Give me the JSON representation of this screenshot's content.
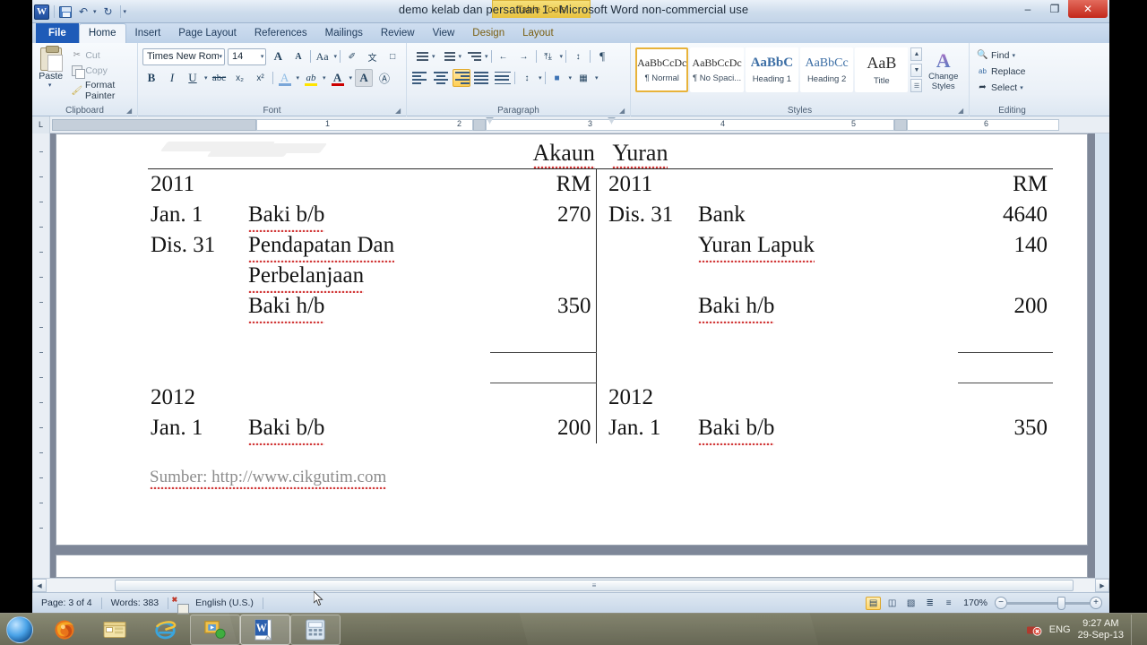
{
  "window": {
    "title": "demo kelab dan persatuan 1  -  Microsoft Word non-commercial use",
    "context_tab_group": "Table Tools",
    "minimize_glyph": "–",
    "restore_glyph": "❐",
    "close_glyph": "✕"
  },
  "quick_access": {
    "app_button": "W",
    "save_tooltip": "Save",
    "undo_glyph": "↶",
    "redo_glyph": "↻",
    "customize_glyph": "▾"
  },
  "tabs": [
    {
      "label": "File",
      "state": "file"
    },
    {
      "label": "Home",
      "state": "active"
    },
    {
      "label": "Insert",
      "state": "normal"
    },
    {
      "label": "Page Layout",
      "state": "normal"
    },
    {
      "label": "References",
      "state": "normal"
    },
    {
      "label": "Mailings",
      "state": "normal"
    },
    {
      "label": "Review",
      "state": "normal"
    },
    {
      "label": "View",
      "state": "normal"
    },
    {
      "label": "Design",
      "state": "context"
    },
    {
      "label": "Layout",
      "state": "context"
    }
  ],
  "ribbon": {
    "clipboard": {
      "group_label": "Clipboard",
      "paste_label": "Paste",
      "paste_arrow": "▾",
      "cut_label": "Cut",
      "copy_label": "Copy",
      "format_painter_label": "Format Painter"
    },
    "font": {
      "group_label": "Font",
      "font_name": "Times New Roma",
      "font_size": "14",
      "grow_font": "A",
      "shrink_font": "A",
      "change_case": "Aa",
      "clear_formatting": "✐",
      "bold": "B",
      "italic": "I",
      "underline": "U",
      "strikethrough": "abc",
      "subscript": "x₂",
      "superscript": "x²",
      "text_effects": "A",
      "highlight": "ab",
      "font_color": "A",
      "phonetic": "文",
      "enclose": "Ⓐ",
      "dropdown_arrow": "▾"
    },
    "paragraph": {
      "group_label": "Paragraph",
      "bullets": "•",
      "numbering": "1.",
      "multilevel": "≡",
      "decrease_indent": "←",
      "increase_indent": "→",
      "sort": "↕",
      "show_marks": "¶",
      "align_left": "left",
      "align_center": "center",
      "align_right": "right",
      "align_justify": "justify",
      "distributed": "distributed",
      "line_spacing": "↕",
      "shading": "■",
      "borders": "▦",
      "active_alignment": "align_right"
    },
    "styles": {
      "group_label": "Styles",
      "items": [
        {
          "preview": "AaBbCcDc",
          "name": "¶ Normal",
          "selected": true
        },
        {
          "preview": "AaBbCcDc",
          "name": "¶ No Spaci...",
          "selected": false
        },
        {
          "preview": "AaBbC",
          "name": "Heading 1",
          "selected": false
        },
        {
          "preview": "AaBbCc",
          "name": "Heading 2",
          "selected": false
        },
        {
          "preview": "AaB",
          "name": "Title",
          "selected": false
        }
      ],
      "change_styles_line1": "Change",
      "change_styles_line2": "Styles",
      "change_styles_arrow": "▾",
      "scroll_up": "▲",
      "scroll_down": "▼",
      "more": "☰"
    },
    "editing": {
      "group_label": "Editing",
      "find_label": "Find",
      "find_arrow": "▾",
      "replace_label": "Replace",
      "select_label": "Select",
      "select_arrow": "▾"
    },
    "help_glyph": "?",
    "minimize_ribbon_glyph": "▴"
  },
  "ruler": {
    "corner_label": "L",
    "h_numbers": [
      "1",
      "2",
      "3",
      "4",
      "5",
      "6"
    ]
  },
  "document": {
    "title_left": "Akaun",
    "title_right": "Yuran",
    "left_side": {
      "year_header": "2011",
      "currency_header": "RM",
      "rows": [
        {
          "date": "Jan. 1",
          "desc": "Baki b/b",
          "spell": true,
          "amount": "270"
        },
        {
          "date": "Dis. 31",
          "desc": "Pendapatan Dan",
          "spell": true,
          "amount": ""
        },
        {
          "date": "",
          "desc": "Perbelanjaan",
          "spell": true,
          "amount": ""
        },
        {
          "date": "",
          "desc": "Baki h/b",
          "spell": true,
          "amount": "350"
        }
      ],
      "closing_year": "2012",
      "closing_row": {
        "date": "Jan. 1",
        "desc": "Baki b/b",
        "amount": "200"
      }
    },
    "right_side": {
      "year_header": "2011",
      "currency_header": "RM",
      "rows": [
        {
          "date": "Dis. 31",
          "desc": "Bank",
          "spell": false,
          "amount": "4640"
        },
        {
          "date": "",
          "desc": "Yuran Lapuk",
          "spell": true,
          "amount": "140"
        },
        {
          "date": "",
          "desc": "",
          "spell": false,
          "amount": ""
        },
        {
          "date": "",
          "desc": "Baki h/b",
          "spell": true,
          "amount": "200"
        }
      ],
      "closing_year": "2012",
      "closing_row": {
        "date": "Jan. 1",
        "desc": "Baki b/b",
        "amount": "350"
      }
    },
    "source_note": "Sumber: http://www.cikgutim.com"
  },
  "status_bar": {
    "page": "Page: 3 of 4",
    "words": "Words: 383",
    "language": "English (U.S.)",
    "proofing_icon": "proofing-errors-icon",
    "views": [
      {
        "name": "print-layout",
        "glyph": "▤",
        "active": true
      },
      {
        "name": "full-screen-reading",
        "glyph": "◫",
        "active": false
      },
      {
        "name": "web-layout",
        "glyph": "▧",
        "active": false
      },
      {
        "name": "outline",
        "glyph": "≣",
        "active": false
      },
      {
        "name": "draft",
        "glyph": "≡",
        "active": false
      }
    ],
    "zoom_level": "170%",
    "zoom_out": "−",
    "zoom_in": "+"
  },
  "taskbar": {
    "start_label": "start-orb",
    "items": [
      {
        "name": "firefox",
        "state": "normal"
      },
      {
        "name": "file-explorer",
        "state": "normal"
      },
      {
        "name": "internet-explorer",
        "state": "normal"
      },
      {
        "name": "screen-recorder",
        "state": "framed"
      },
      {
        "name": "microsoft-word",
        "state": "active"
      },
      {
        "name": "calculator",
        "state": "framed"
      }
    ],
    "tray": {
      "language": "ENG",
      "time": "9:27 AM",
      "date": "29-Sep-13"
    }
  },
  "colors": {
    "accent_blue": "#1e5bb8",
    "context_yellow": "#e8c23f",
    "close_red": "#c3281b",
    "spell_red": "#d23b3b",
    "highlight_gold": "#ffd66a"
  }
}
